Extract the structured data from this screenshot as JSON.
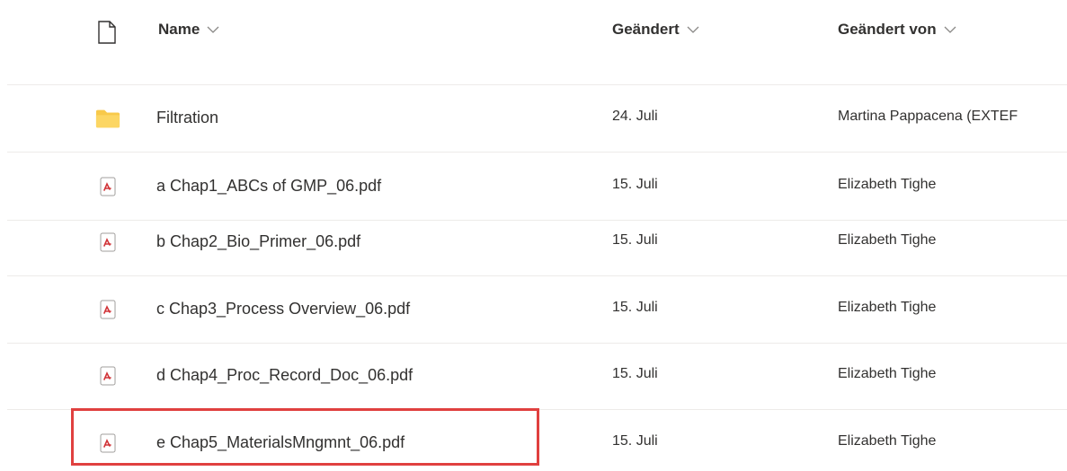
{
  "header": {
    "name_label": "Name",
    "modified_label": "Geändert",
    "modified_by_label": "Geändert von"
  },
  "files": [
    {
      "name": "Filtration",
      "modified": "24. Juli",
      "modified_by": "Martina Pappacena (EXTEF",
      "type": "folder"
    },
    {
      "name": "a Chap1_ABCs of GMP_06.pdf",
      "modified": "15. Juli",
      "modified_by": "Elizabeth Tighe",
      "type": "pdf"
    },
    {
      "name": "b Chap2_Bio_Primer_06.pdf",
      "modified": "15. Juli",
      "modified_by": "Elizabeth Tighe",
      "type": "pdf"
    },
    {
      "name": "c Chap3_Process Overview_06.pdf",
      "modified": "15. Juli",
      "modified_by": "Elizabeth Tighe",
      "type": "pdf"
    },
    {
      "name": "d Chap4_Proc_Record_Doc_06.pdf",
      "modified": "15. Juli",
      "modified_by": "Elizabeth Tighe",
      "type": "pdf"
    },
    {
      "name": "e Chap5_MaterialsMngmnt_06.pdf",
      "modified": "15. Juli",
      "modified_by": "Elizabeth Tighe",
      "type": "pdf"
    }
  ],
  "icons": {
    "header_file": "document-icon",
    "folder": "folder-icon",
    "pdf": "pdf-icon"
  },
  "colors": {
    "folder": "#f8c94a",
    "pdf_accent": "#d13438",
    "highlight": "#e0403f"
  }
}
